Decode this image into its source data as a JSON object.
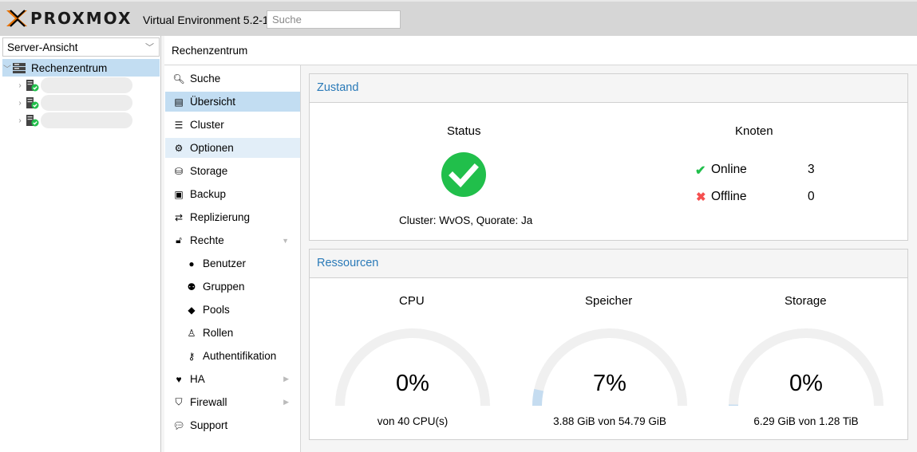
{
  "header": {
    "logo_text": "PROXMOX",
    "version": "Virtual Environment 5.2-1",
    "search_placeholder": "Suche"
  },
  "tree": {
    "view_select": "Server-Ansicht",
    "root_label": "Rechenzentrum",
    "nodes_count_shown": 3
  },
  "breadcrumb": "Rechenzentrum",
  "nav": {
    "items": [
      {
        "label": "Suche",
        "icon": "search-icon"
      },
      {
        "label": "Übersicht",
        "icon": "book-icon"
      },
      {
        "label": "Cluster",
        "icon": "server-icon"
      },
      {
        "label": "Optionen",
        "icon": "gear-icon"
      },
      {
        "label": "Storage",
        "icon": "database-icon"
      },
      {
        "label": "Backup",
        "icon": "floppy-icon"
      },
      {
        "label": "Replizierung",
        "icon": "retweet-icon"
      },
      {
        "label": "Rechte",
        "icon": "unlock-icon"
      },
      {
        "label": "Benutzer",
        "icon": "user-icon"
      },
      {
        "label": "Gruppen",
        "icon": "users-icon"
      },
      {
        "label": "Pools",
        "icon": "tags-icon"
      },
      {
        "label": "Rollen",
        "icon": "male-icon"
      },
      {
        "label": "Authentifikation",
        "icon": "key-icon"
      },
      {
        "label": "HA",
        "icon": "heartbeat-icon"
      },
      {
        "label": "Firewall",
        "icon": "shield-icon"
      },
      {
        "label": "Support",
        "icon": "comments-icon"
      }
    ]
  },
  "status_panel": {
    "title": "Zustand",
    "status_heading": "Status",
    "cluster_line": "Cluster: WvOS, Quorate: Ja",
    "nodes_heading": "Knoten",
    "online_label": "Online",
    "online_count": "3",
    "offline_label": "Offline",
    "offline_count": "0"
  },
  "resources_panel": {
    "title": "Ressourcen",
    "gauges": [
      {
        "label": "CPU",
        "value_text": "0%",
        "fraction": 0.0,
        "detail": "von 40 CPU(s)"
      },
      {
        "label": "Speicher",
        "value_text": "7%",
        "fraction": 0.07,
        "detail": "3.88 GiB von 54.79 GiB"
      },
      {
        "label": "Storage",
        "value_text": "0%",
        "fraction": 0.005,
        "detail": "6.29 GiB von 1.28 TiB"
      }
    ]
  },
  "colors": {
    "accent_blue": "#2a7ab8",
    "ok_green": "#21bf4b",
    "error_red": "#f54f4f",
    "gauge_track": "#f0f0f0",
    "gauge_fill": "#c5dcf0",
    "logo_orange": "#e57000"
  }
}
